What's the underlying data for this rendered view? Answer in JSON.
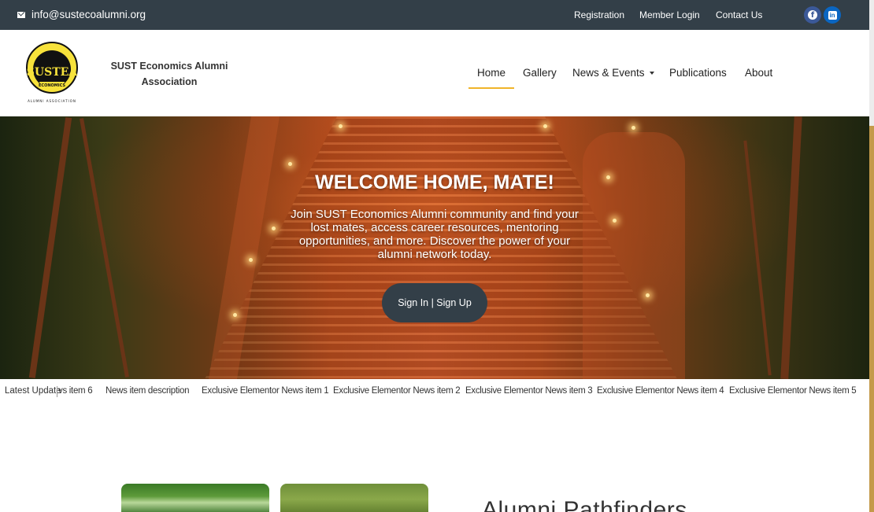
{
  "topbar": {
    "email": "info@sustecoalumni.org",
    "links": [
      "Registration",
      "Member Login",
      "Contact Us"
    ],
    "social": [
      {
        "name": "facebook-icon",
        "color": "#3b5998"
      },
      {
        "name": "linkedin-icon",
        "color": "#0a66c2"
      }
    ],
    "background": "#333f48"
  },
  "header": {
    "site_title": "SUST Economics Alumni Association",
    "logo_text": "SUSTEA",
    "logo_ring_text": "ECONOMICS",
    "logo_caption": "ALUMNI ASSOCIATION",
    "nav": [
      "Home",
      "Gallery",
      "News & Events",
      "Publications",
      "About"
    ],
    "active_nav": "Home",
    "accent": "#f0b429"
  },
  "hero": {
    "title": "WELCOME HOME, MATE!",
    "text": "Join SUST Economics Alumni community and find your lost mates, access career resources, mentoring opportunities, and more. Discover the power of your alumni network today.",
    "button": "Sign In | Sign Up"
  },
  "ticker": {
    "label": "Latest Update",
    "items": [
      "vs item 6",
      "News item description",
      "Exclusive Elementor News item 1",
      "Exclusive Elementor News item 2",
      "Exclusive Elementor News item 3",
      "Exclusive Elementor News item 4",
      "Exclusive Elementor News item 5"
    ]
  },
  "section": {
    "title": "Alumni Pathfinders"
  }
}
